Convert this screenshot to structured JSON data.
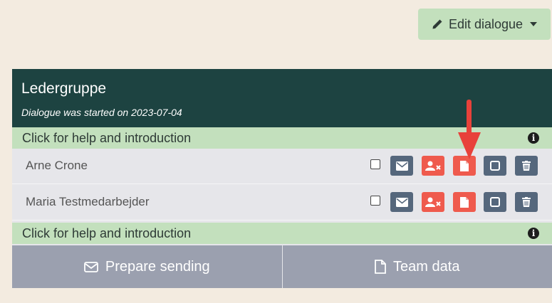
{
  "toolbar": {
    "edit_dialogue_label": "Edit dialogue"
  },
  "panel": {
    "title": "Ledergruppe",
    "subtitle": "Dialogue was started on 2023-07-04"
  },
  "help": {
    "label": "Click for help and introduction"
  },
  "participants": [
    {
      "name": "Arne Crone"
    },
    {
      "name": "Maria Testmedarbejder"
    }
  ],
  "footer": {
    "prepare_sending_label": "Prepare sending",
    "team_data_label": "Team data"
  },
  "colors": {
    "header": "#1d4341",
    "help_bar": "#c3e0bd",
    "slate_button": "#55677c",
    "red_button": "#ef5a4d",
    "annotation_arrow": "#e8413a"
  },
  "icons": {
    "row_buttons": [
      "envelope-icon",
      "user-remove-icon",
      "document-icon",
      "square-icon",
      "trash-icon"
    ]
  }
}
